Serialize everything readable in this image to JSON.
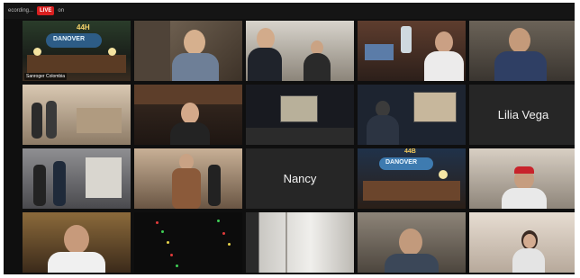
{
  "header": {
    "recording_text": "ecording...",
    "live_badge": "LIVE",
    "live_extra": "on"
  },
  "tiles": [
    {
      "id": "t1",
      "label": "Sanroger Colombia",
      "name_only": false,
      "active": true
    },
    {
      "id": "t2",
      "label": "",
      "name_only": false
    },
    {
      "id": "t3",
      "label": "",
      "name_only": false
    },
    {
      "id": "t4",
      "label": "",
      "name_only": false
    },
    {
      "id": "t5",
      "label": "",
      "name_only": false
    },
    {
      "id": "t6",
      "label": "",
      "name_only": false
    },
    {
      "id": "t7",
      "label": "",
      "name_only": false
    },
    {
      "id": "t8",
      "label": "",
      "name_only": false
    },
    {
      "id": "t9",
      "label": "",
      "name_only": false
    },
    {
      "id": "t10",
      "label": "Lilia Vega",
      "name_only": true
    },
    {
      "id": "t11",
      "label": "",
      "name_only": false
    },
    {
      "id": "t12",
      "label": "",
      "name_only": false
    },
    {
      "id": "t13",
      "label": "Nancy",
      "name_only": true
    },
    {
      "id": "t14",
      "label": "",
      "name_only": false
    },
    {
      "id": "t15",
      "label": "",
      "name_only": false
    },
    {
      "id": "t16",
      "label": "",
      "name_only": false
    },
    {
      "id": "t17",
      "label": "",
      "name_only": false
    },
    {
      "id": "t18",
      "label": "",
      "name_only": false
    },
    {
      "id": "t19",
      "label": "",
      "name_only": false
    },
    {
      "id": "t20",
      "label": "",
      "name_only": false
    }
  ],
  "scene_text": {
    "bar_sign_1": "DANOVER",
    "bar_sign_2": "DANOVER",
    "sign_number": "44H",
    "sign_number_2": "44B"
  },
  "colors": {
    "active_border": "#8dcf3f",
    "live_red": "#d81f1f",
    "background": "#0f0f0f"
  }
}
